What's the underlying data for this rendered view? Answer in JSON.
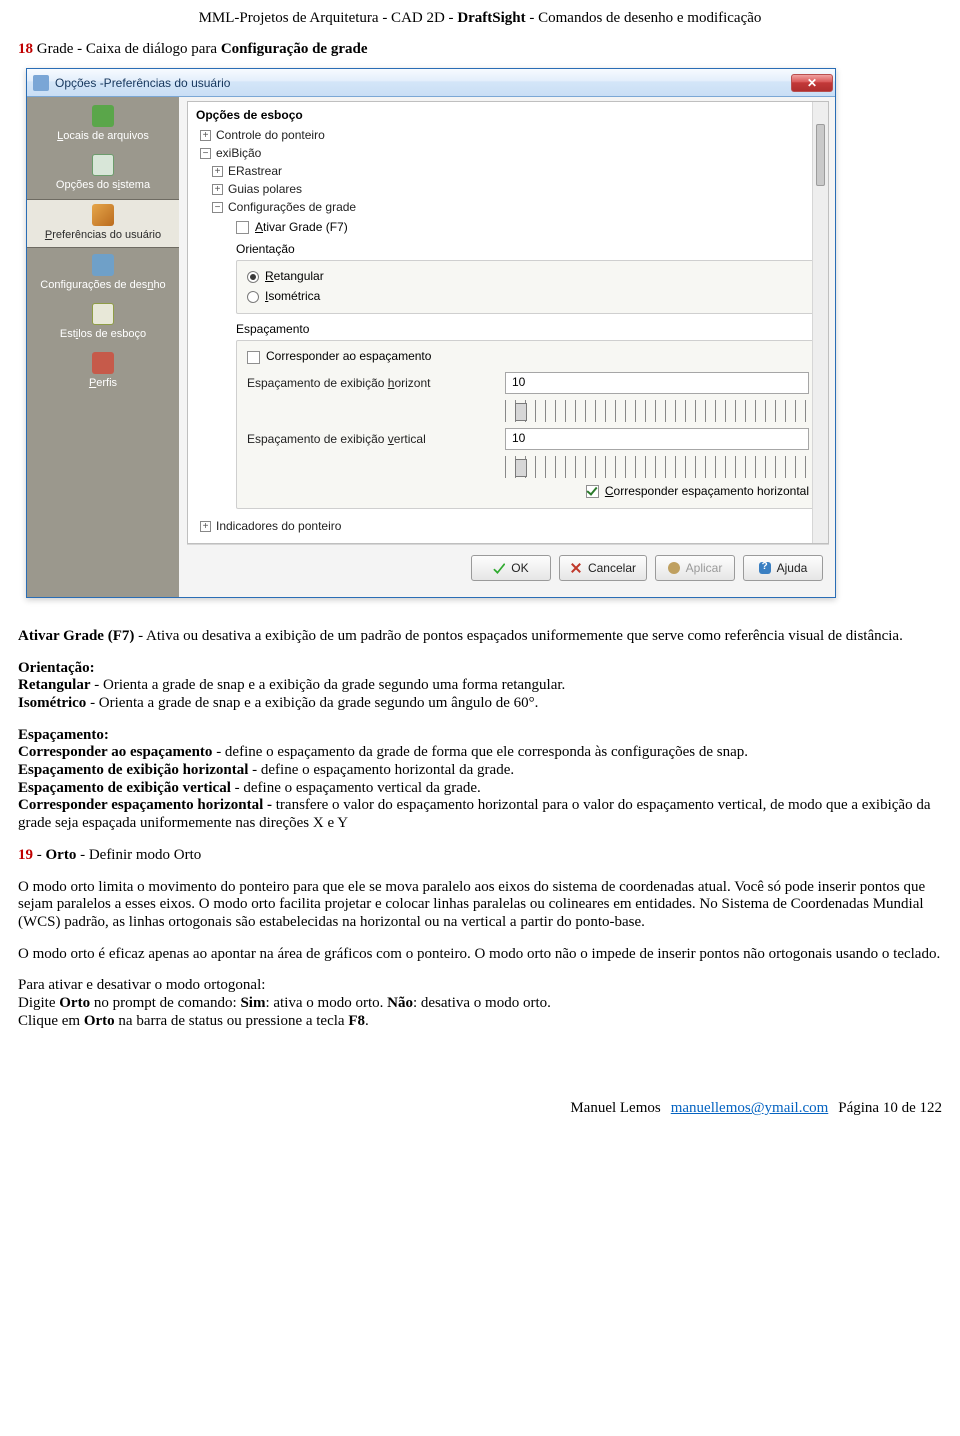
{
  "header": {
    "prefix": "MML-Projetos de Arquitetura - CAD 2D - ",
    "product": "DraftSight",
    "suffix": " - Comandos de desenho e  modificação"
  },
  "section18": {
    "num": "18",
    "text": " Grade - Caixa de diálogo para ",
    "bold": "Configuração de grade"
  },
  "dialog": {
    "title": "Opções -Preferências do usuário",
    "sidebar": {
      "items": [
        {
          "u": "L",
          "label": "ocais de arquivos",
          "color": "#5aa64a"
        },
        {
          "u": "",
          "label": "Opções do s",
          "mid_u": "i",
          "label2": "stema",
          "color": "#69a56d"
        },
        {
          "u": "P",
          "label": "referências do usuário",
          "color": "#d88b2a",
          "selected": true
        },
        {
          "u": "",
          "label": "Configurações de des",
          "mid_u": "n",
          "label2": "ho",
          "color": "#6fa0c8"
        },
        {
          "u": "",
          "label": "Est",
          "mid_u": "i",
          "label2": "los de esboço",
          "color": "#8f9d46"
        },
        {
          "u": "P",
          "label": "erfis",
          "color": "#c65a4a"
        }
      ]
    },
    "tree": {
      "root": "Opções de esboço",
      "nodes": [
        {
          "label": "Controle do ponteiro",
          "toggle": "+"
        },
        {
          "label": "exiBição",
          "toggle": "−",
          "children": [
            {
              "label": "ERastrear",
              "toggle": "+"
            },
            {
              "label": "Guias polares",
              "toggle": "+"
            },
            {
              "label": "Configurações de grade",
              "toggle": "−"
            }
          ]
        },
        {
          "label": "Indicadores do ponteiro",
          "toggle": "+"
        }
      ]
    },
    "grid": {
      "activate_u": "A",
      "activate": "tivar Grade (F7)",
      "orient_label": "Orientação",
      "rect_u": "R",
      "rect": "etangular",
      "iso_u": "I",
      "iso": "sométrica",
      "spacing_label": "Espaçamento",
      "match_spacing": "Corresponder ao espaçamento",
      "h_label_pre": "Espaçamento de exibição ",
      "h_u": "h",
      "h_label_post": "orizont",
      "v_label_pre": "Espaçamento de exibição ",
      "v_u": "v",
      "v_label_post": "ertical",
      "h_value": "10",
      "v_value": "10",
      "match_h_u": "C",
      "match_h": "orresponder espaçamento horizontal"
    },
    "buttons": {
      "ok": "OK",
      "cancel": "Cancelar",
      "apply": "Aplicar",
      "help": "Ajuda"
    }
  },
  "body": {
    "p1_b": "Ativar Grade (F7)",
    "p1": " - Ativa ou desativa a exibição de um padrão de pontos espaçados uniformemente que serve como referência visual de distância.",
    "orient_h": "Orientação:",
    "p2_b": "Retangular",
    "p2": " - Orienta a grade de snap e a exibição da grade segundo uma forma retangular.",
    "p3_b": "Isométrico",
    "p3": " - Orienta a grade de snap e a exibição da grade segundo um ângulo de 60°.",
    "spacing_h": "Espaçamento:",
    "p4_b": "Corresponder ao espaçamento",
    "p4": " - define o espaçamento da grade de forma que ele corresponda às configurações de snap.",
    "p5_b": "Espaçamento de exibição horizontal",
    "p5": " - define o espaçamento horizontal da grade.",
    "p6_b": "Espaçamento de exibição vertical",
    "p6": " - define o espaçamento vertical da grade.",
    "p7_b": "Corresponder espaçamento horizontal - ",
    "p7": "transfere o valor do espaçamento horizontal para o valor do espaçamento vertical, de modo que a exibição da grade seja espaçada uniformemente nas direções X e Y",
    "s19_num": "19",
    "s19_b": "Orto",
    "s19": " - Definir modo Orto",
    "p8": "O modo orto limita o movimento do ponteiro para que ele se mova paralelo aos eixos do sistema de coordenadas atual. Você só pode inserir pontos que sejam paralelos a esses eixos. O modo orto facilita projetar e colocar linhas paralelas ou colineares em entidades. No Sistema de Coordenadas Mundial (WCS) padrão, as linhas ortogonais são estabelecidas na horizontal ou na vertical a partir do ponto-base.",
    "p9": "O modo orto é eficaz apenas ao apontar na área de gráficos com o ponteiro. O modo orto não o impede de inserir pontos não ortogonais usando o teclado.",
    "p10_pre": "Para ativar e desativar o modo ortogonal:",
    "p11a": "Digite ",
    "p11b": "Orto",
    "p11c": " no prompt de comando: ",
    "p11d": "Sim",
    "p11e": ": ativa o modo orto. ",
    "p11f": "Não",
    "p11g": ": desativa o modo orto.",
    "p12a": "Clique em ",
    "p12b": "Orto",
    "p12c": " na barra de status ou pressione a tecla ",
    "p12d": "F8",
    "p12e": "."
  },
  "footer": {
    "author": "Manuel Lemos",
    "email": "manuellemos@ymail.com",
    "page": "Página 10 de 122"
  }
}
